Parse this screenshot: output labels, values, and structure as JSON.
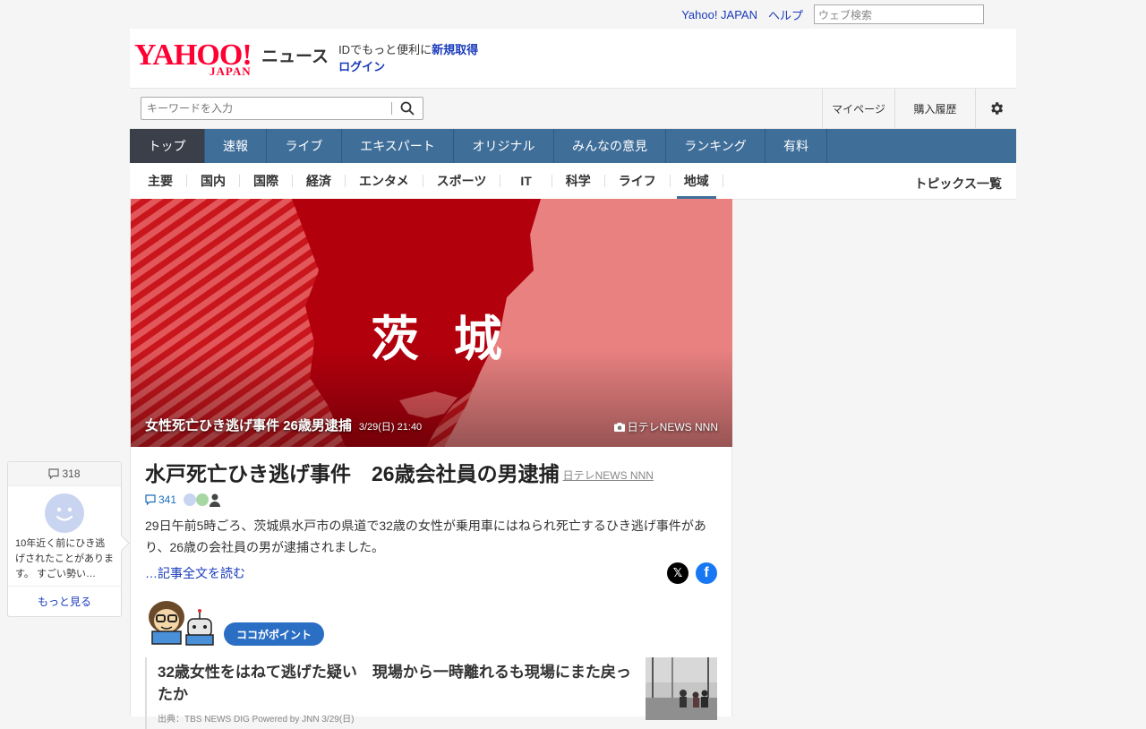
{
  "util": {
    "yahoo_japan": "Yahoo! JAPAN",
    "help": "ヘルプ",
    "web_search_placeholder": "ウェブ検索"
  },
  "header": {
    "logo_main": "YAHOO!",
    "logo_sub": "JAPAN",
    "logo_news": "ニュース",
    "id_text": "IDでもっと便利に",
    "signup": "新規取得",
    "login": "ログイン"
  },
  "search": {
    "placeholder": "キーワードを入力",
    "mypage": "マイページ",
    "history": "購入履歴"
  },
  "main_nav": [
    {
      "label": "トップ",
      "active": true
    },
    {
      "label": "速報"
    },
    {
      "label": "ライブ"
    },
    {
      "label": "エキスパート"
    },
    {
      "label": "オリジナル"
    },
    {
      "label": "みんなの意見"
    },
    {
      "label": "ランキング"
    },
    {
      "label": "有料"
    }
  ],
  "sub_nav": [
    {
      "label": "主要"
    },
    {
      "label": "国内"
    },
    {
      "label": "国際"
    },
    {
      "label": "経済"
    },
    {
      "label": "エンタメ"
    },
    {
      "label": "スポーツ"
    },
    {
      "label": "IT"
    },
    {
      "label": "科学"
    },
    {
      "label": "ライフ"
    },
    {
      "label": "地域",
      "active": true
    }
  ],
  "topics_all": "トピックス一覧",
  "hero": {
    "caption": "女性死亡ひき逃げ事件 26歳男逮捕",
    "datetime": "3/29(日) 21:40",
    "credit": "日テレNEWS NNN",
    "map_text": "茨 城"
  },
  "article": {
    "title": "水戸死亡ひき逃げ事件　26歳会社員の男逮捕",
    "source": "日テレNEWS NNN",
    "comment_count": "341",
    "lead": "29日午前5時ごろ、茨城県水戸市の県道で32歳の女性が乗用車にはねられ死亡するひき逃げ事件があり、26歳の会社員の男が逮捕されました。",
    "read_more": "…記事全文を読む",
    "x_label": "𝕏",
    "fb_label": "f",
    "point_badge": "ココがポイント",
    "related_title": "32歳女性をはねて逃げた疑い　現場から一時離れるも現場にまた戻ったか",
    "related_source": "出典：TBS NEWS DIG Powered by JNN 3/29(日)"
  },
  "comment_card": {
    "count": "318",
    "text": "10年近く前にひき逃げされたことがあります。 すごい勢い…",
    "more": "もっと見る"
  },
  "colors": {
    "brand_red": "#ff0033",
    "nav_blue": "#3f6e99",
    "nav_active": "#3a3f4a",
    "link_blue": "#1a3bbb",
    "badge_blue": "#2a6fc4"
  }
}
